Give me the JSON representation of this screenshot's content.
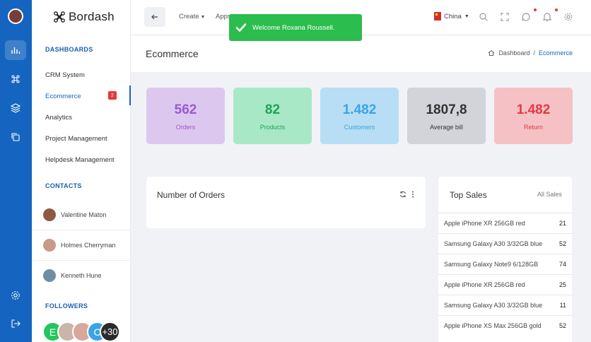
{
  "app": {
    "name": "Bordash"
  },
  "colors": {
    "accent": "#1565c0",
    "toast": "#2bbd4d",
    "badge": "#e53935"
  },
  "sidebar": {
    "dashboards_heading": "DASHBOARDS",
    "items": [
      {
        "label": "CRM System"
      },
      {
        "label": "Ecommerce",
        "badge": "2",
        "active": true
      },
      {
        "label": "Analytics"
      },
      {
        "label": "Project Management"
      },
      {
        "label": "Helpdesk Management"
      }
    ],
    "contacts_heading": "CONTACTS",
    "contacts": [
      {
        "name": "Valentine Maton"
      },
      {
        "name": "Holmes Cherryman"
      },
      {
        "name": "Kenneth Hune"
      }
    ],
    "followers_heading": "FOLLOWERS",
    "followers": [
      {
        "initial": "E",
        "color": "#22c55e"
      },
      {
        "initial": "",
        "color": "#c9b6a8"
      },
      {
        "initial": "",
        "color": "#d8a89a"
      },
      {
        "initial": "C",
        "color": "#3aa3e3"
      },
      {
        "initial": "+30",
        "color": "#2b2b2b"
      }
    ]
  },
  "topbar": {
    "menu": [
      {
        "label": "Create"
      },
      {
        "label": "Apps"
      }
    ],
    "country": "China",
    "icons": [
      "search-icon",
      "fullscreen-icon",
      "chat-icon",
      "bell-icon",
      "gear-icon"
    ]
  },
  "toast": {
    "message": "Welcome Roxana Roussell."
  },
  "page": {
    "title": "Ecommerce",
    "breadcrumb": {
      "home": "Dashboard",
      "separator": "/",
      "current": "Ecommerce"
    }
  },
  "stats": [
    {
      "value": "562",
      "label": "Orders",
      "bg": "#dcc8ee",
      "fg": "#9b59d0"
    },
    {
      "value": "82",
      "label": "Products",
      "bg": "#a9e8c6",
      "fg": "#1aa557"
    },
    {
      "value": "1.482",
      "label": "Customers",
      "bg": "#b7def4",
      "fg": "#3aa3e3"
    },
    {
      "value": "1807,8",
      "label": "Average bill",
      "bg": "#d2d4da",
      "fg": "#333333"
    },
    {
      "value": "1.482",
      "label": "Return",
      "bg": "#f5c1c4",
      "fg": "#e53945"
    }
  ],
  "orders_card": {
    "title": "Number of Orders"
  },
  "top_sales": {
    "title": "Top Sales",
    "link": "All Sales",
    "rows": [
      {
        "product": "Apple iPhone XR 256GB red",
        "qty": "21"
      },
      {
        "product": "Samsung Galaxy A30 3/32GB blue",
        "qty": "52"
      },
      {
        "product": "Samsung Galaxy Note9 6/128GB",
        "qty": "74"
      },
      {
        "product": "Apple iPhone XR 256GB red",
        "qty": "25"
      },
      {
        "product": "Samsung Galaxy A30 3/32GB blue",
        "qty": "11"
      },
      {
        "product": "Apple iPhone XS Max 256GB gold",
        "qty": "52"
      }
    ]
  }
}
